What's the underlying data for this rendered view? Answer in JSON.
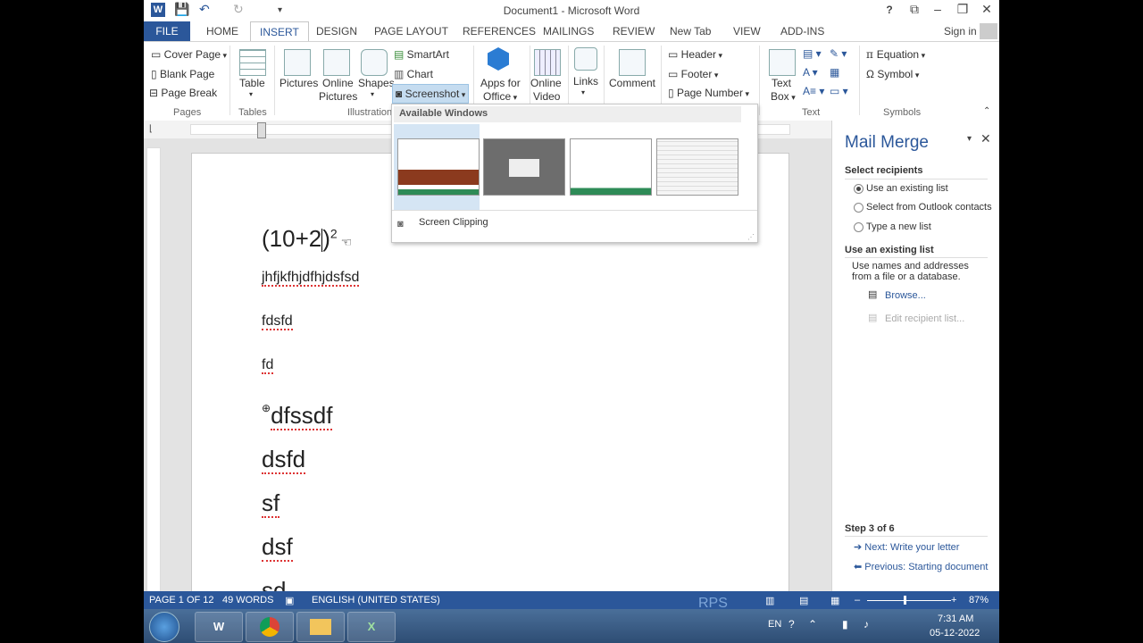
{
  "window": {
    "title": "Document1 - Microsoft Word",
    "help": "?",
    "minimize": "–",
    "restore": "❐",
    "close": "✕"
  },
  "quick_access": {
    "save": "💾",
    "undo": "↶",
    "redo": "↻",
    "customize": "▾"
  },
  "tabs": [
    "FILE",
    "HOME",
    "INSERT",
    "DESIGN",
    "PAGE LAYOUT",
    "REFERENCES",
    "MAILINGS",
    "REVIEW",
    "New Tab",
    "VIEW",
    "ADD-INS"
  ],
  "sign_in": "Sign in",
  "ribbon": {
    "pages": {
      "items": [
        "Cover Page",
        "Blank Page",
        "Page Break"
      ],
      "group": "Pages"
    },
    "tables": {
      "table": "Table",
      "group": "Tables"
    },
    "illustrations": {
      "pictures": "Pictures",
      "online_pictures_1": "Online",
      "online_pictures_2": "Pictures",
      "shapes": "Shapes",
      "smartart": "SmartArt",
      "chart": "Chart",
      "screenshot": "Screenshot",
      "group": "Illustration"
    },
    "apps": {
      "line1": "Apps for",
      "line2": "Office"
    },
    "media": {
      "line1": "Online",
      "line2": "Video"
    },
    "links": "Links",
    "comment": "Comment",
    "header_footer": {
      "header": "Header",
      "footer": "Footer",
      "page_number": "Page Number"
    },
    "text": {
      "textbox_1": "Text",
      "textbox_2": "Box",
      "group": "Text"
    },
    "symbols": {
      "equation": "Equation",
      "symbol": "Symbol",
      "group": "Symbols"
    }
  },
  "screenshot_menu": {
    "heading": "Available Windows",
    "clipping": "Screen Clipping"
  },
  "document": {
    "equation_base": "(10+2",
    "equation_close": ")",
    "exponent": "2",
    "lines": [
      "jhfjkfhjdfhjdsfsd",
      "fdsfd",
      "fd",
      "dfssdf",
      "dsfd",
      "sf",
      "dsf",
      "sd"
    ]
  },
  "mail_merge": {
    "title": "Mail Merge",
    "select_heading": "Select recipients",
    "options": [
      "Use an existing list",
      "Select from Outlook contacts",
      "Type a new list"
    ],
    "existing_heading": "Use an existing list",
    "desc1": "Use names and addresses",
    "desc2": "from a file or a database.",
    "browse": "Browse...",
    "edit": "Edit recipient list...",
    "step": "Step 3 of 6",
    "next": "Next: Write your letter",
    "previous": "Previous: Starting document"
  },
  "status": {
    "page": "PAGE 1 OF 12",
    "words": "49 WORDS",
    "language": "ENGLISH (UNITED STATES)",
    "watermark": "RPS",
    "zoom_minus": "–",
    "zoom_plus": "+",
    "zoom": "87%",
    "zoom_level": 0.45
  },
  "taskbar": {
    "lang": "EN",
    "time": "7:31 AM",
    "date": "05-12-2022",
    "apps": [
      "W",
      "",
      "",
      "X"
    ]
  },
  "colors": {
    "accent": "#2b579a",
    "squiggle": "#dd3333"
  }
}
